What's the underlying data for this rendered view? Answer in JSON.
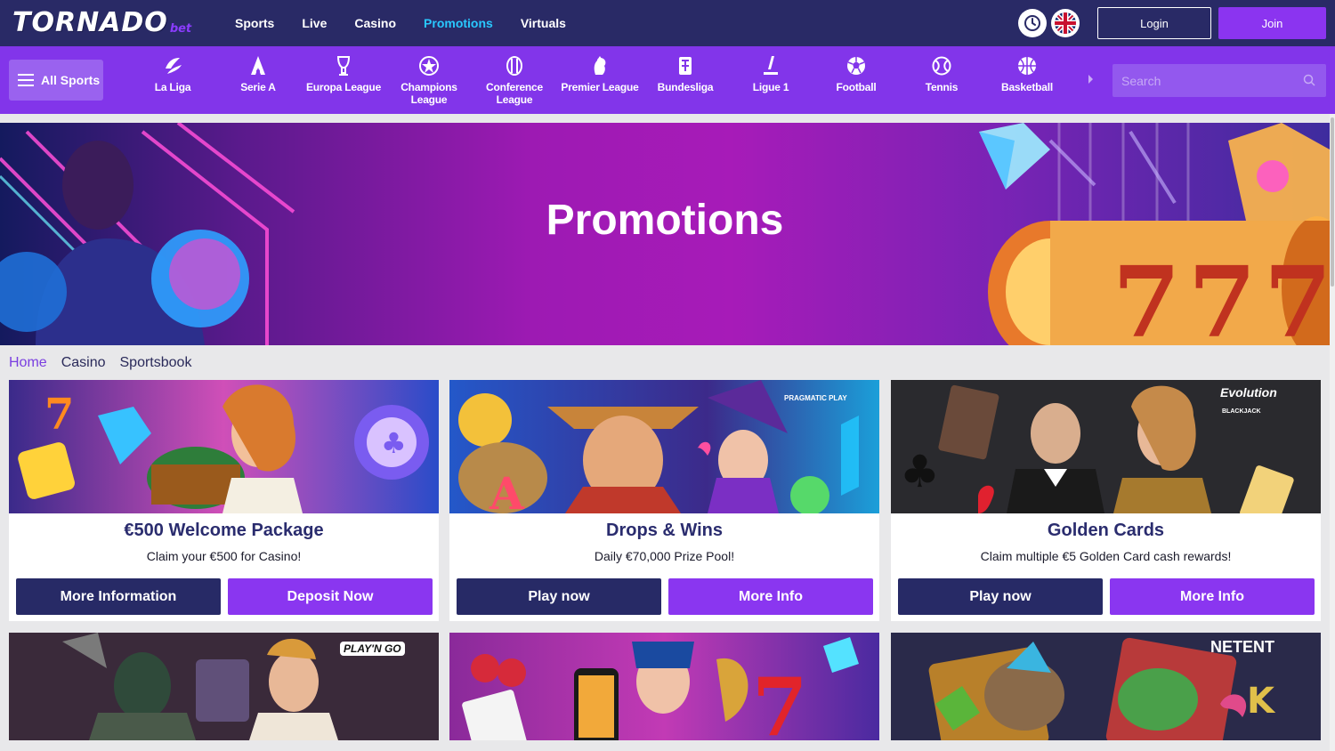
{
  "brand": {
    "name": "TORNADO",
    "suffix": "bet"
  },
  "topnav": {
    "links": [
      {
        "label": "Sports",
        "active": false
      },
      {
        "label": "Live",
        "active": false
      },
      {
        "label": "Casino",
        "active": false
      },
      {
        "label": "Promotions",
        "active": true
      },
      {
        "label": "Virtuals",
        "active": false
      }
    ],
    "login_label": "Login",
    "join_label": "Join"
  },
  "sportsbar": {
    "all_sports_label": "All Sports",
    "items": [
      {
        "label": "La Liga",
        "icon": "laliga-icon"
      },
      {
        "label": "Serie A",
        "icon": "seriea-icon"
      },
      {
        "label": "Europa League",
        "icon": "europa-league-icon"
      },
      {
        "label": "Champions League",
        "icon": "champions-league-icon"
      },
      {
        "label": "Conference League",
        "icon": "conference-league-icon"
      },
      {
        "label": "Premier League",
        "icon": "premier-league-icon"
      },
      {
        "label": "Bundesliga",
        "icon": "bundesliga-icon"
      },
      {
        "label": "Ligue 1",
        "icon": "ligue1-icon"
      },
      {
        "label": "Football",
        "icon": "football-icon"
      },
      {
        "label": "Tennis",
        "icon": "tennis-icon"
      },
      {
        "label": "Basketball",
        "icon": "basketball-icon"
      }
    ],
    "search_placeholder": "Search"
  },
  "hero": {
    "title": "Promotions"
  },
  "breadcrumb": {
    "items": [
      "Home",
      "Casino",
      "Sportsbook"
    ]
  },
  "promos": [
    {
      "title": "€500 Welcome Package",
      "subtitle": "Claim your €500 for Casino!",
      "btn_primary": "More Information",
      "btn_secondary": "Deposit Now"
    },
    {
      "title": "Drops & Wins",
      "subtitle": "Daily €70,000 Prize Pool!",
      "btn_primary": "Play now",
      "btn_secondary": "More Info",
      "provider": "PRAGMATIC PLAY"
    },
    {
      "title": "Golden Cards",
      "subtitle": "Claim multiple €5 Golden Card cash rewards!",
      "btn_primary": "Play now",
      "btn_secondary": "More Info",
      "provider": "Evolution",
      "provider_sub": "BLACKJACK"
    }
  ],
  "promos_row2": [
    {
      "provider": "PLAY'N GO"
    },
    {
      "provider": ""
    },
    {
      "provider": "NETENT"
    }
  ],
  "colors": {
    "topbar": "#292a66",
    "sportsbar": "#8235ea",
    "accent_purple": "#8a36f0",
    "active_link": "#29c8ff",
    "card_title": "#2a2c6e"
  }
}
